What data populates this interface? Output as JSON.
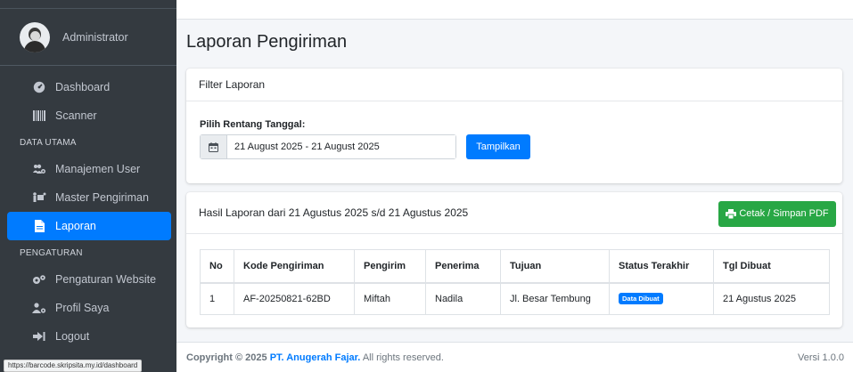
{
  "sidebar": {
    "user": {
      "name": "Administrator"
    },
    "items": [
      {
        "label": "Dashboard",
        "icon": "tachometer-icon"
      },
      {
        "label": "Scanner",
        "icon": "barcode-icon"
      }
    ],
    "section_data_utama": "DATA UTAMA",
    "items_data": [
      {
        "label": "Manajemen User",
        "icon": "users-cog-icon"
      },
      {
        "label": "Master Pengiriman",
        "icon": "people-carry-icon"
      },
      {
        "label": "Laporan",
        "icon": "file-icon",
        "active": true
      }
    ],
    "section_pengaturan": "PENGATURAN",
    "items_settings": [
      {
        "label": "Pengaturan Website",
        "icon": "cogs-icon"
      },
      {
        "label": "Profil Saya",
        "icon": "user-cog-icon"
      },
      {
        "label": "Logout",
        "icon": "sign-out-icon"
      }
    ]
  },
  "status_url": "https://barcode.skripsita.my.id/dashboard",
  "page": {
    "title": "Laporan Pengiriman"
  },
  "filter": {
    "card_title": "Filter Laporan",
    "range_label": "Pilih Rentang Tanggal:",
    "range_value": "21 August 2025 - 21 August 2025",
    "submit_label": "Tampilkan"
  },
  "result": {
    "title": "Hasil Laporan dari 21 Agustus 2025 s/d 21 Agustus 2025",
    "print_label": "Cetak / Simpan PDF",
    "columns": [
      "No",
      "Kode Pengiriman",
      "Pengirim",
      "Penerima",
      "Tujuan",
      "Status Terakhir",
      "Tgl Dibuat"
    ],
    "rows": [
      {
        "no": "1",
        "kode": "AF-20250821-62BD",
        "pengirim": "Miftah",
        "penerima": "Nadila",
        "tujuan": "Jl. Besar Tembung",
        "status": "Data Dibuat",
        "tgl": "21 Agustus 2025"
      }
    ]
  },
  "footer": {
    "copyright_prefix": "Copyright © 2025 ",
    "company": "PT. Anugerah Fajar.",
    "rights": " All rights reserved.",
    "version": "Versi 1.0.0"
  },
  "colors": {
    "primary": "#007bff",
    "success": "#28a745",
    "sidebar": "#343a40"
  }
}
